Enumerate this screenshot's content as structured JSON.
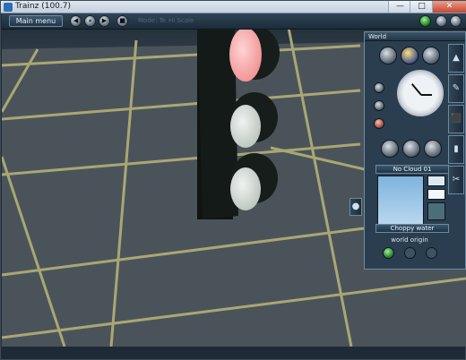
{
  "window": {
    "title": "Trainz",
    "version": "(100.7)",
    "minimize": "—",
    "maximize": "□",
    "close": "✕"
  },
  "toolbar": {
    "main_menu_label": "Main menu",
    "buttons": [
      "◀",
      "⏸",
      "▶",
      "■"
    ],
    "faded_text_1": "Mode: Te",
    "faded_text_2": "Hi Scale"
  },
  "world_panel": {
    "title": "World",
    "cloud_label": "No Cloud 01",
    "water_label": "Choppy water",
    "origin_label": "world origin"
  },
  "colors": {
    "accent": "#6d8aa0",
    "panel_bg": "#2a3e4f",
    "ground": "#4b535a",
    "grid": "#a9a773",
    "sky": "#2d3a45"
  },
  "icons": {
    "toolbar_round": "round-button-icon",
    "green_status": "green-dot-icon",
    "clock": "clock-icon",
    "side_tab_1": "terrain-tab-icon",
    "side_tab_2": "track-tab-icon",
    "side_tab_3": "object-tab-icon"
  }
}
